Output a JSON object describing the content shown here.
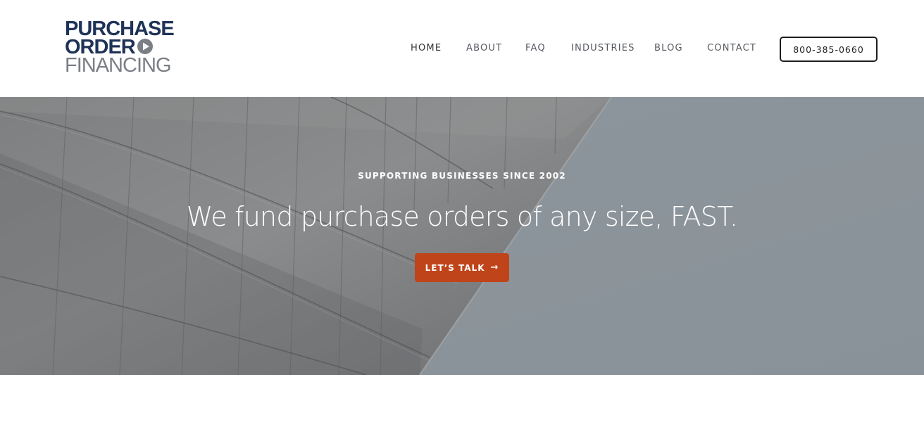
{
  "logo": {
    "line1": "PURCHASE",
    "line2": "ORDER",
    "line3": "FINANCING",
    "icon": "play-icon"
  },
  "nav": {
    "items": [
      {
        "label": "HOME",
        "active": true
      },
      {
        "label": "ABOUT"
      },
      {
        "label": "FAQ"
      },
      {
        "label": "INDUSTRIES"
      },
      {
        "label": "BLOG"
      },
      {
        "label": "CONTACT"
      }
    ],
    "phone": "800-385-0660"
  },
  "hero": {
    "eyebrow": "SUPPORTING BUSINESSES SINCE 2002",
    "title": "We fund purchase orders of any size, FAST.",
    "cta_label": "LET’S TALK",
    "cta_icon": "→"
  },
  "colors": {
    "brand_navy": "#1f3358",
    "brand_gray": "#7a7f86",
    "cta_orange": "#c0441a",
    "sky": "#8c949b"
  }
}
